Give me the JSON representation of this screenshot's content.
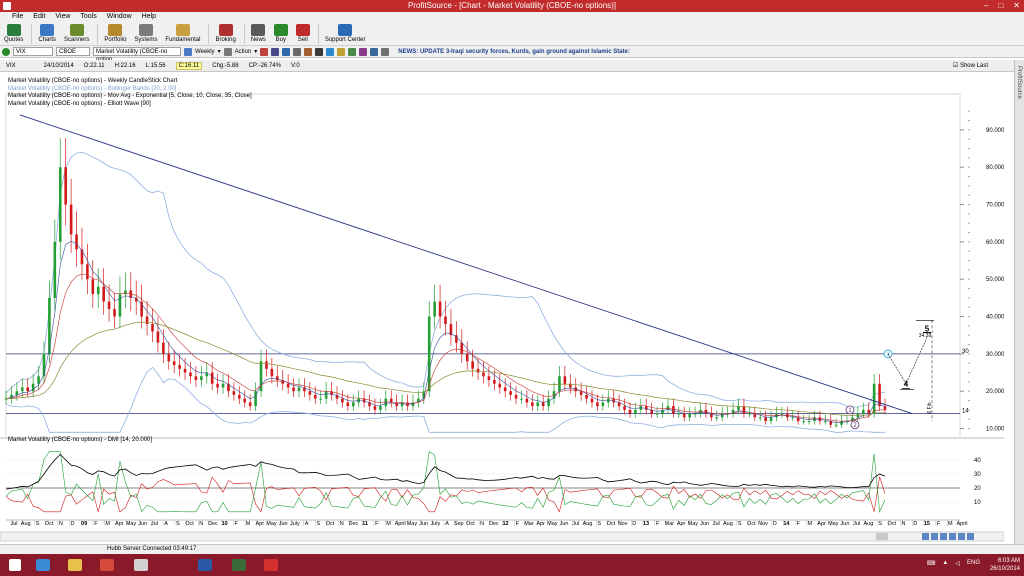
{
  "window": {
    "title": "ProfitSource - [Chart - Market Volatility (CBOE-no options)]",
    "controls": [
      "–",
      "□",
      "✕"
    ]
  },
  "menu": [
    "File",
    "Edit",
    "View",
    "Tools",
    "Window",
    "Help"
  ],
  "toolbar": [
    {
      "label": "Quotes",
      "color": "#2a7d3c"
    },
    {
      "label": "Charts",
      "color": "#3a78c6"
    },
    {
      "label": "Scanners",
      "color": "#6a8c2a"
    },
    {
      "label": "Portfolio",
      "color": "#b6892a"
    },
    {
      "label": "Systems",
      "color": "#7a7a7a"
    },
    {
      "label": "Fundamental",
      "color": "#c8a040"
    },
    {
      "label": "Broking",
      "color": "#b03030"
    },
    {
      "label": "News",
      "color": "#5a5a5a"
    },
    {
      "label": "Buy",
      "color": "#2a8a2a"
    },
    {
      "label": "Sell",
      "color": "#c02a2a"
    },
    {
      "label": "Support Center",
      "color": "#2a6ab6"
    }
  ],
  "row2": {
    "symbol": "VIX",
    "exchange": "CBOE",
    "instrument": "Market Volatility (CBOE-no option",
    "period": "Weekly",
    "action": "Action",
    "news": "NEWS: UPDATE 3-Iraqi security forces, Kurds, gain ground against Islamic State:"
  },
  "quote": {
    "symbol": "VIX",
    "date": "24/10/2014",
    "open": "O:22.11",
    "high": "H:22.16",
    "low": "L:15.56",
    "close": "C:16.11",
    "chg": "Chg:-5.88",
    "cp": "CP:-26.74%",
    "vol": "V:0",
    "show_last": "Show Last"
  },
  "legend": [
    "Market Volatility (CBOE-no options) - Weekly CandleStick Chart",
    "Market Volatility (CBOE-no options) - Bollinger Bands [20, 2.00]",
    "Market Volatility (CBOE-no options) - Mov Avg - Exponential [5, Close, 10, Close, 35, Close]",
    "Market Volatility (CBOE-no options) - Elliott Wave [90]"
  ],
  "dmi_legend": "Market Volatility (CBOE-no options) - DMI [14, 20.000]",
  "status": {
    "server": "Hubb Server Connected 03:49:17"
  },
  "tray": {
    "lang": "ENG",
    "time": "6:03 AM",
    "date": "26/10/2014"
  },
  "taskbar_apps": [
    {
      "name": "start",
      "color": "#ffffff"
    },
    {
      "name": "internet-explorer",
      "color": "#3a8ad6"
    },
    {
      "name": "file-explorer",
      "color": "#e8c04a"
    },
    {
      "name": "chrome",
      "color": "#d64a3a"
    },
    {
      "name": "calculator",
      "color": "#d0d0d0"
    },
    {
      "name": "word",
      "color": "#2a5aa6"
    },
    {
      "name": "app-gc",
      "color": "#3a6a3a"
    },
    {
      "name": "profitsource",
      "color": "#d43030"
    }
  ],
  "colors": {
    "bull": "#22a033",
    "bear": "#d21a1a",
    "bollinger": "#8fb0e0",
    "ema5": "#3a4fa0",
    "ema10": "#c8302a",
    "ema35": "#8a8a30",
    "trendline": "#2a3480",
    "dmi_adx": "#000000",
    "dmi_plus": "#22a033",
    "dmi_minus": "#d21a1a",
    "taskbar": "#8a1a2a",
    "titlebar": "#c12b2b"
  },
  "chart_data": {
    "type": "candlestick",
    "y_ticks": [
      "90.000",
      "80.000",
      "70.000",
      "60.000",
      "50.000",
      "40.000",
      "30.000",
      "20.000",
      "10.000"
    ],
    "ylim": [
      8,
      98
    ],
    "x_labels": [
      "Jul",
      "Aug",
      "S",
      "Oct",
      "N",
      "D",
      "09",
      "F",
      "M",
      "Apr",
      "May",
      "Jun",
      "Jul",
      "A",
      "S",
      "Oct",
      "N",
      "Dec",
      "10",
      "F",
      "M",
      "Apr",
      "May",
      "Jun",
      "July",
      "A",
      "S",
      "Oct",
      "N",
      "Dec",
      "11",
      "F",
      "M",
      "April",
      "May",
      "Jun",
      "July",
      "A",
      "Sep",
      "Oct",
      "N",
      "Dec",
      "12",
      "F",
      "Mar",
      "Apr",
      "May",
      "Jun",
      "Jul",
      "Aug",
      "S",
      "Oct",
      "Nov",
      "D",
      "13",
      "F",
      "Mar",
      "Apr",
      "May",
      "Jun",
      "Jul",
      "Aug",
      "S",
      "Oct",
      "Nov",
      "D",
      "14",
      "F",
      "M",
      "Apr",
      "May",
      "Jun",
      "Jul",
      "Aug",
      "S",
      "Oct",
      "N",
      "D",
      "15",
      "F",
      "M",
      "April"
    ],
    "hlines": [
      {
        "value": 30,
        "label": "30"
      },
      {
        "value": 14,
        "label": "14"
      }
    ],
    "trendline": {
      "from": {
        "x_index": 0,
        "value": 94
      },
      "to": {
        "x_index": 1.0,
        "value": 14
      }
    },
    "waves": [
      {
        "label": "3",
        "value": 30
      },
      {
        "label": "1",
        "value": 15
      },
      {
        "label": "2",
        "value": 10
      },
      {
        "label": "4",
        "value": 22
      },
      {
        "label": "5",
        "value": 34.38
      }
    ],
    "wave5_target_label": "34.38",
    "fib_label": "6 Fib",
    "closes": [
      18,
      19,
      20,
      21,
      20,
      22,
      24,
      30,
      45,
      60,
      80,
      70,
      62,
      58,
      54,
      50,
      46,
      48,
      44,
      42,
      40,
      46,
      47,
      45,
      44,
      40,
      38,
      36,
      33,
      30,
      28,
      27,
      26,
      25,
      24,
      23,
      24,
      25,
      22,
      21,
      22,
      20,
      19,
      18,
      17,
      16,
      20,
      28,
      26,
      24,
      23,
      22,
      21,
      20,
      21,
      20,
      19,
      18,
      18,
      20,
      19,
      18,
      17,
      16,
      17,
      18,
      17,
      16,
      15,
      16,
      18,
      17,
      16,
      17,
      16,
      17,
      18,
      20,
      40,
      44,
      40,
      38,
      35,
      33,
      30,
      28,
      26,
      25,
      24,
      23,
      22,
      21,
      20,
      19,
      18,
      18,
      17,
      16,
      17,
      16,
      18,
      20,
      24,
      22,
      21,
      20,
      19,
      18,
      17,
      16,
      17,
      18,
      17,
      16,
      15,
      14,
      15,
      16,
      15,
      14,
      14,
      15,
      16,
      14,
      14,
      13,
      14,
      14,
      15,
      14,
      13,
      13,
      14,
      14,
      15,
      16,
      14,
      14,
      13,
      13,
      12,
      13,
      14,
      14,
      13,
      13,
      12,
      12,
      12,
      13,
      12,
      12,
      11,
      11,
      12,
      12,
      13,
      14,
      15,
      14,
      22,
      16,
      15
    ],
    "dmi_y_ticks": [
      "40",
      "30",
      "20",
      "10"
    ],
    "dmi_ylim": [
      0,
      50
    ]
  }
}
